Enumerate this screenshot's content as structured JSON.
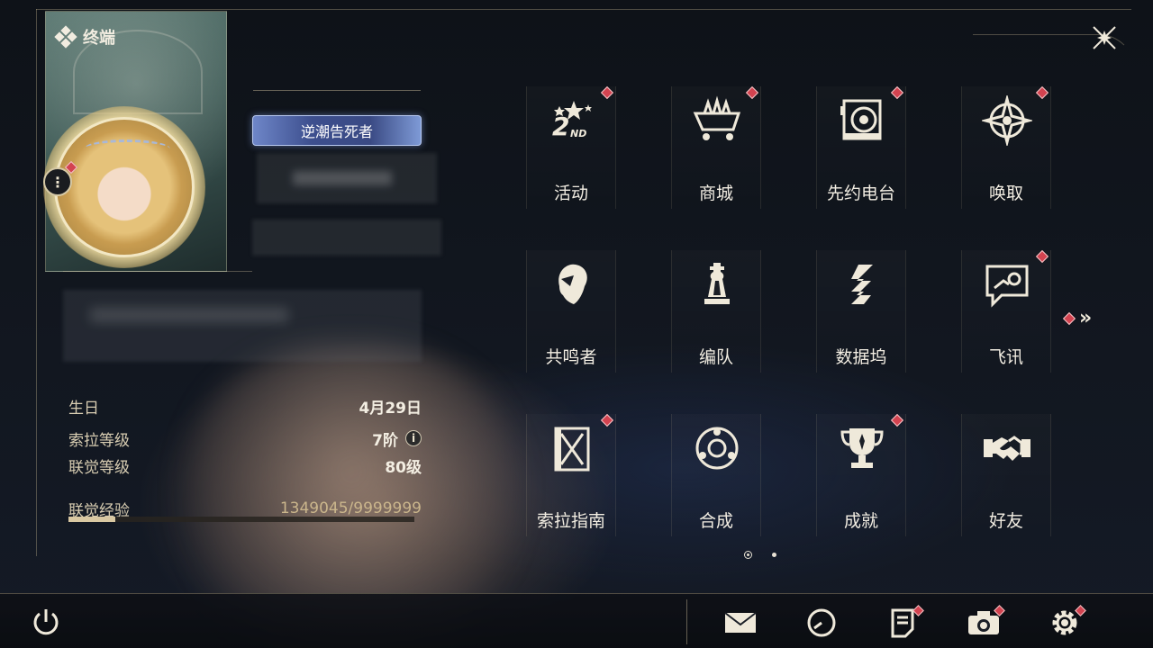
{
  "header": {
    "title": "终端"
  },
  "profile": {
    "title_badge": "逆潮告死者",
    "birthday_label": "生日",
    "birthday_value": "4月29日",
    "sola_level_label": "索拉等级",
    "sola_level_value": "7阶",
    "union_level_label": "联觉等级",
    "union_level_value": "80级",
    "union_exp_label": "联觉经验",
    "union_exp_value": "1349045/9999999",
    "union_exp_progress": 0.135
  },
  "menu": {
    "items": [
      {
        "label": "活动",
        "icon": "2nd-anniversary-icon",
        "badge": true
      },
      {
        "label": "商城",
        "icon": "shop-cart-icon",
        "badge": true
      },
      {
        "label": "先约电台",
        "icon": "radio-icon",
        "badge": true
      },
      {
        "label": "唤取",
        "icon": "summon-compass-icon",
        "badge": true
      },
      {
        "label": "共鸣者",
        "icon": "resonator-portrait-icon",
        "badge": false
      },
      {
        "label": "编队",
        "icon": "chess-team-icon",
        "badge": false
      },
      {
        "label": "数据坞",
        "icon": "data-bank-icon",
        "badge": false
      },
      {
        "label": "飞讯",
        "icon": "message-icon",
        "badge": true
      },
      {
        "label": "索拉指南",
        "icon": "guide-book-icon",
        "badge": true
      },
      {
        "label": "合成",
        "icon": "synthesis-icon",
        "badge": false
      },
      {
        "label": "成就",
        "icon": "trophy-icon",
        "badge": true
      },
      {
        "label": "好友",
        "icon": "handshake-icon",
        "badge": false
      }
    ],
    "current_page": 1,
    "page_count": 2
  },
  "toolbar": {
    "buttons": [
      "mail-icon",
      "clock-icon",
      "notice-icon",
      "camera-icon",
      "settings-icon"
    ]
  },
  "colors": {
    "badge": "#d34350",
    "accent": "#d9c8a2",
    "title_badge_bg": "#3d4f8e"
  }
}
